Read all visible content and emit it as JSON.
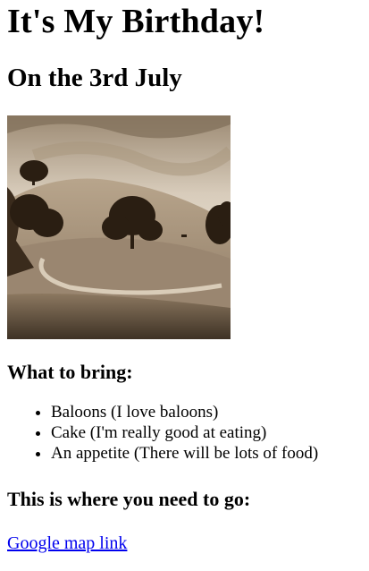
{
  "page": {
    "title": "It's My Birthday!",
    "subtitle": "On the 3rd July",
    "image": {
      "icon": "landscape-photo",
      "tone": "sepia",
      "colors": {
        "sky_light": "#e2d8c9",
        "sky_dark": "#8c7b66",
        "hill": "#a49077",
        "tree": "#2a1e12",
        "ground": "#6b5a46"
      }
    },
    "bring_heading": "What to bring:",
    "bring_items": [
      "Baloons (I love baloons)",
      "Cake (I'm really good at eating)",
      "An appetite (There will be lots of food)"
    ],
    "location_heading": "This is where you need to go:",
    "map_link": {
      "label": "Google map link",
      "color": "#0000ee"
    }
  }
}
